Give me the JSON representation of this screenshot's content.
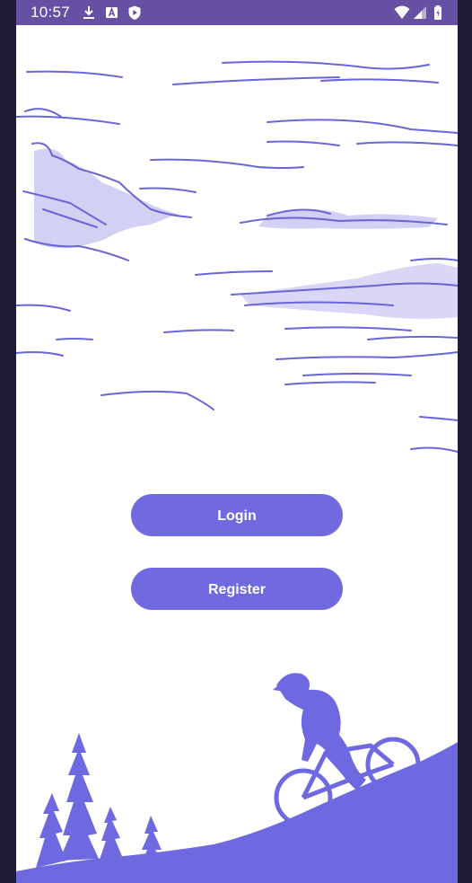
{
  "status_bar": {
    "time": "10:57",
    "left_icons": [
      "download-icon",
      "a-badge-icon",
      "shield-play-icon"
    ],
    "right_icons": [
      "wifi-icon",
      "signal-icon",
      "battery-icon"
    ]
  },
  "buttons": {
    "login": "Login",
    "register": "Register"
  },
  "colors": {
    "status_bar": "#6650a4",
    "accent": "#7169e0",
    "background": "#ffffff"
  }
}
